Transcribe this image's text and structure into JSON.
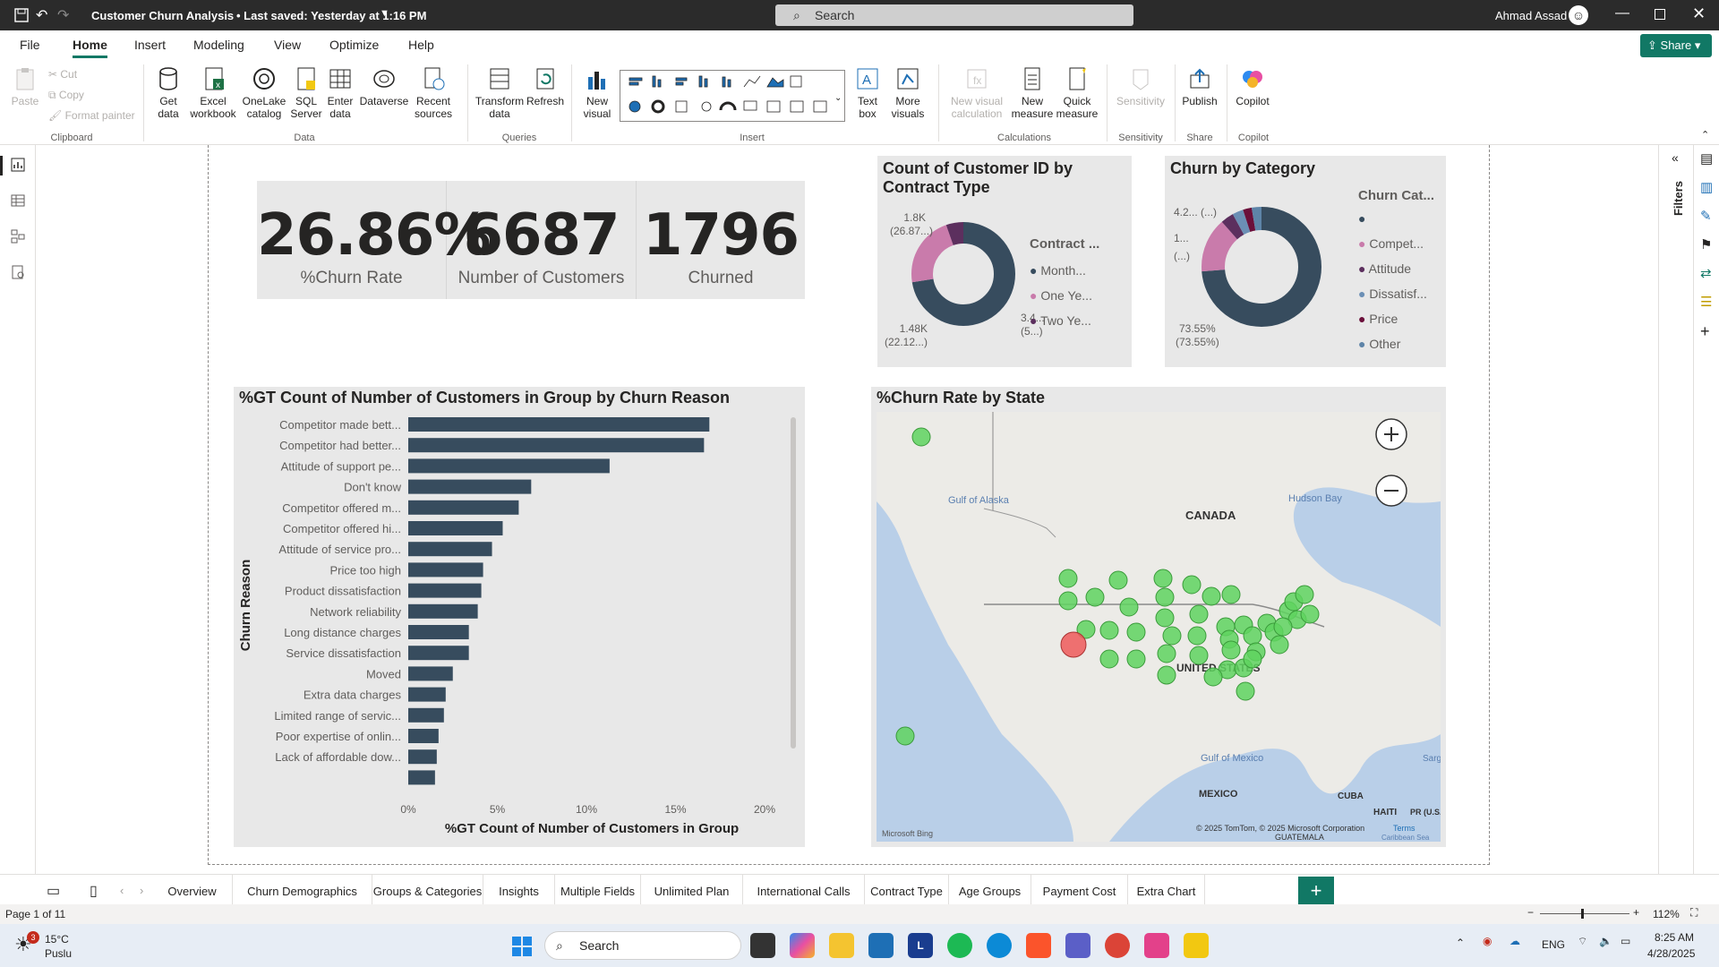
{
  "titlebar": {
    "doc_title": "Customer Churn Analysis",
    "saved": "• Last saved: Yesterday at 1:16 PM",
    "search_placeholder": "Search",
    "user": "Ahmad Assad",
    "share": "Share"
  },
  "menu": [
    "File",
    "Home",
    "Insert",
    "Modeling",
    "View",
    "Optimize",
    "Help"
  ],
  "ribbon": {
    "paste": "Paste",
    "cut": "Cut",
    "copy": "Copy",
    "format_painter": "Format painter",
    "get_data": "Get data",
    "excel": "Excel workbook",
    "onelake": "OneLake catalog",
    "sql": "SQL Server",
    "enter": "Enter data",
    "dataverse": "Dataverse",
    "recent": "Recent sources",
    "transform": "Transform data",
    "refresh": "Refresh",
    "new_visual": "New visual",
    "text_box": "Text box",
    "more_visuals": "More visuals",
    "new_visual_calc": "New visual calculation",
    "new_measure": "New measure",
    "quick_measure": "Quick measure",
    "sensitivity": "Sensitivity",
    "publish": "Publish",
    "copilot": "Copilot",
    "groups": {
      "clipboard": "Clipboard",
      "data": "Data",
      "queries": "Queries",
      "insert": "Insert",
      "calculations": "Calculations",
      "sensitivity": "Sensitivity",
      "share": "Share",
      "copilot": "Copilot"
    }
  },
  "kpis": [
    {
      "value": "26.86%",
      "label": "%Churn Rate"
    },
    {
      "value": "6687",
      "label": "Number of Customers"
    },
    {
      "value": "1796",
      "label": "Churned"
    }
  ],
  "contract_chart": {
    "title": "Count of Customer ID by Contract Type",
    "legend_title": "Contract ...",
    "legend": [
      "Month...",
      "One Ye...",
      "Two Ye..."
    ],
    "labels": {
      "a": "1.8K",
      "a2": "(26.87...)",
      "b": "1.48K",
      "b2": "(22.12...)",
      "c": "3.4...",
      "c2": "(5...)"
    },
    "colors": [
      "#374c5e",
      "#c97bab",
      "#5c2f5e"
    ]
  },
  "category_chart": {
    "title": "Churn by Category",
    "legend_title": "Churn Cat...",
    "legend": [
      "",
      "Compet...",
      "Attitude",
      "Dissatisf...",
      "Price",
      "Other"
    ],
    "labels": {
      "a": "4.2...",
      "a2": "(...)",
      "b": "1...",
      "b2": "(...)",
      "c": "73.55%",
      "c2": "(73.55%)"
    },
    "colors": [
      "#374c5e",
      "#c97bab",
      "#5c2f5e",
      "#6b8fb5",
      "#6b0f3a",
      "#5e84a8"
    ]
  },
  "chart_data": {
    "type": "bar",
    "title": "%GT Count of Number of Customers in Group by Churn Reason",
    "xlabel": "%GT Count of Number of Customers in Group",
    "ylabel": "Churn Reason",
    "xlim": [
      0,
      20
    ],
    "xticks": [
      "0%",
      "5%",
      "10%",
      "15%",
      "20%"
    ],
    "categories": [
      "Competitor made bett...",
      "Competitor had better...",
      "Attitude of support pe...",
      "Don't know",
      "Competitor offered m...",
      "Competitor offered hi...",
      "Attitude of service pro...",
      "Price too high",
      "Product dissatisfaction",
      "Network reliability",
      "Long distance charges",
      "Service dissatisfaction",
      "Moved",
      "Extra data charges",
      "Limited range of servic...",
      "Poor expertise of onlin...",
      "Lack of affordable dow...",
      ""
    ],
    "values": [
      16.9,
      16.6,
      11.3,
      6.9,
      6.2,
      5.3,
      4.7,
      4.2,
      4.1,
      3.9,
      3.4,
      3.4,
      2.5,
      2.1,
      2.0,
      1.7,
      1.6,
      1.5
    ]
  },
  "map": {
    "title": "%Churn Rate by State",
    "canada": "CANADA",
    "us": "UNITED STATES",
    "mexico": "MEXICO",
    "gulf_alaska": "Gulf of Alaska",
    "hudson": "Hudson Bay",
    "gulf_mexico": "Gulf of Mexico",
    "cuba": "CUBA",
    "haiti": "HAITI",
    "pr": "PR (U.S.)",
    "sarg": "Sarg",
    "bing": "Microsoft Bing",
    "copyright": "© 2025 TomTom, © 2025 Microsoft Corporation",
    "terms": "Terms",
    "guatemala": "GUATEMALA",
    "caribbean": "Caribbean Sea"
  },
  "right_pane": {
    "filters": "Filters"
  },
  "tabs": [
    "Overview",
    "Churn Demographics",
    "Groups & Categories",
    "Insights",
    "Multiple Fields",
    "Unlimited Plan",
    "International Calls",
    "Contract Type",
    "Age Groups",
    "Payment Cost",
    "Extra Chart"
  ],
  "status": {
    "page": "Page 1 of 11",
    "zoom": "112%"
  },
  "taskbar": {
    "temp": "15°C",
    "weather": "Puslu",
    "badge": "3",
    "search": "Search",
    "lang": "ENG",
    "time": "8:25 AM",
    "date": "4/28/2025"
  }
}
